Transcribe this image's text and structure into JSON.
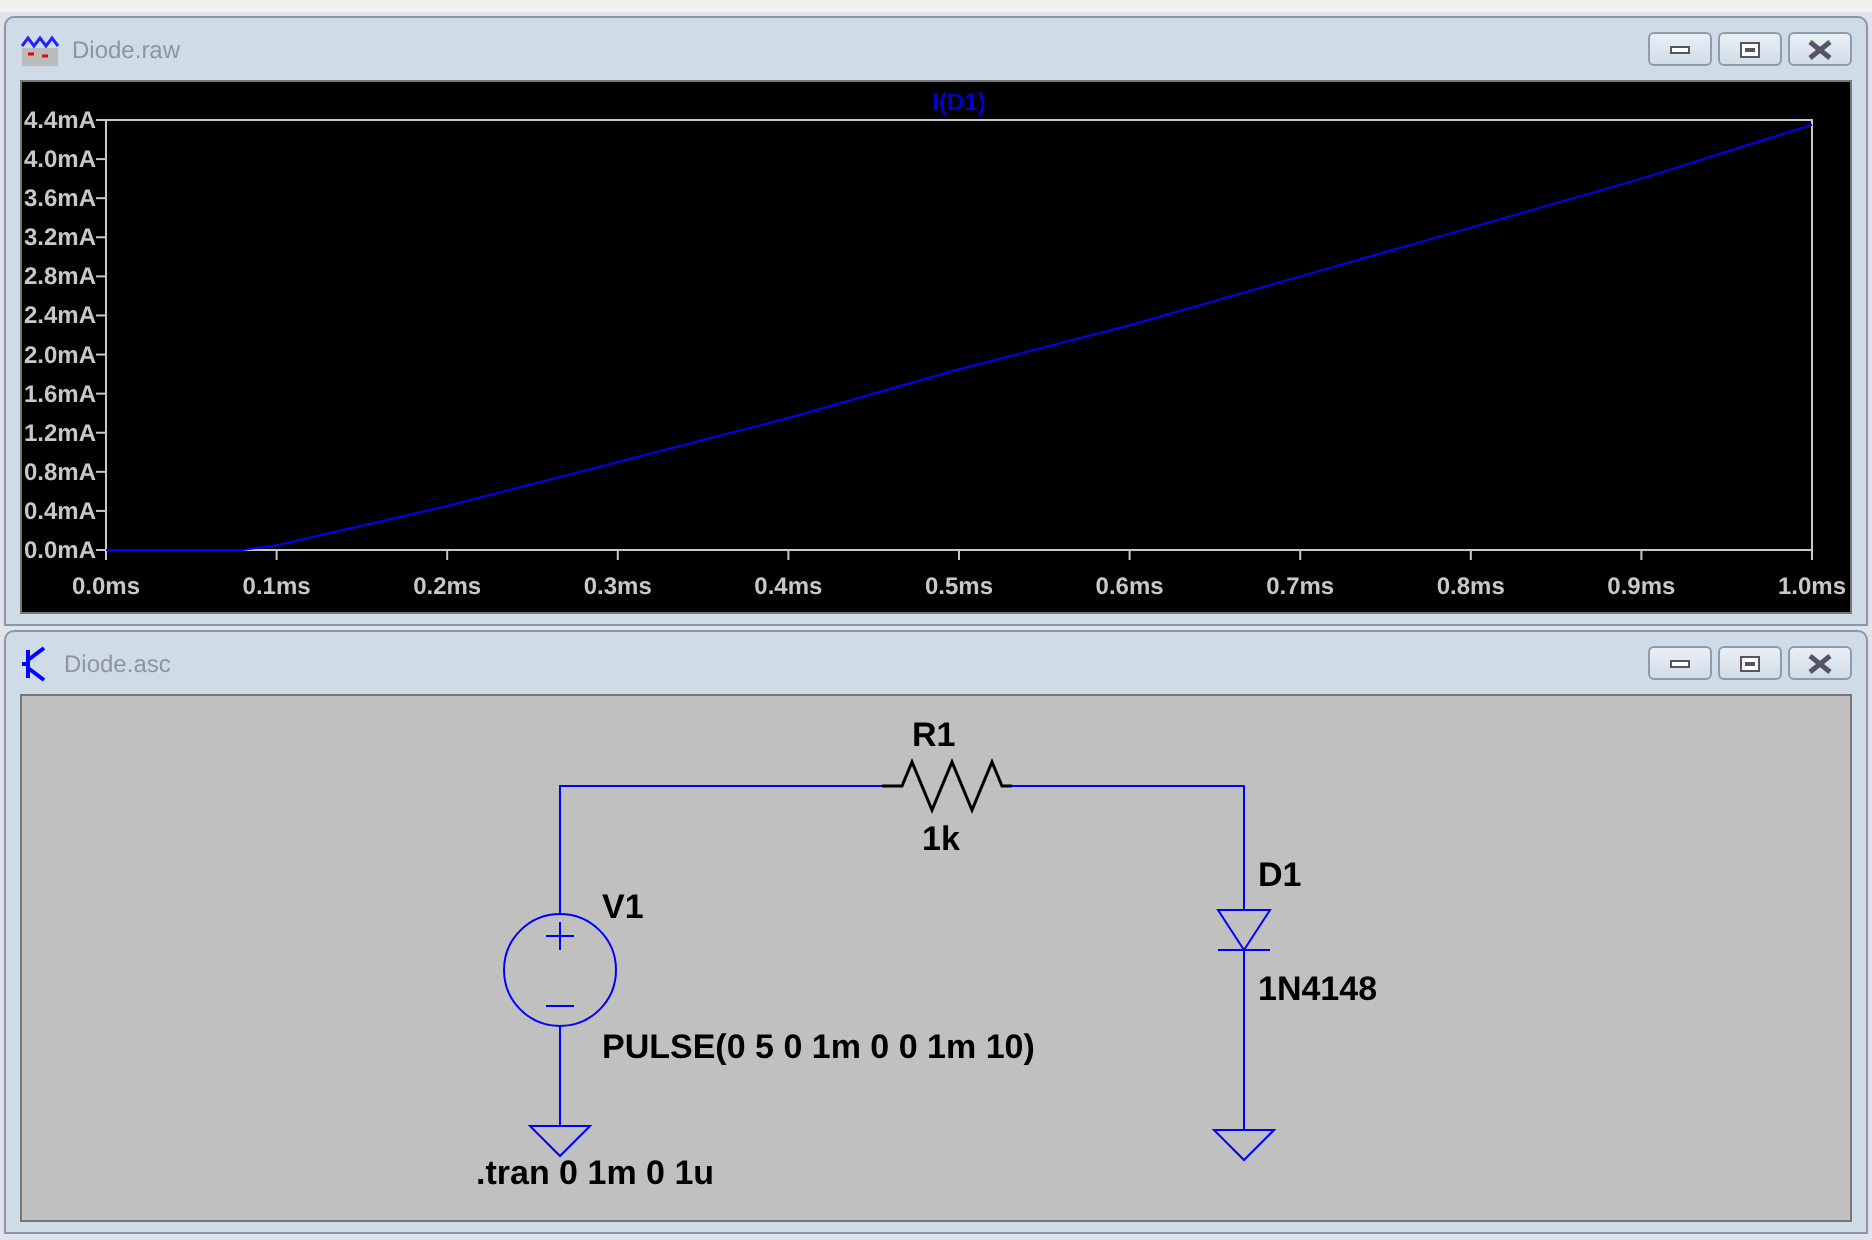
{
  "waveform_window": {
    "title": "Diode.raw",
    "chart_data": {
      "type": "line",
      "x": [
        0,
        0.08,
        0.1,
        0.2,
        0.3,
        0.4,
        0.5,
        0.6,
        0.7,
        0.8,
        0.9,
        1.0
      ],
      "series": [
        {
          "name": "I(D1)",
          "color": "#0000ff",
          "values": [
            0,
            0,
            0.05,
            0.45,
            0.9,
            1.35,
            1.85,
            2.3,
            2.8,
            3.3,
            3.8,
            4.35
          ]
        }
      ],
      "xlim": [
        0,
        1
      ],
      "ylim": [
        0,
        4.4
      ],
      "xticks": [
        {
          "value": 0,
          "label": "0.0ms"
        },
        {
          "value": 0.1,
          "label": "0.1ms"
        },
        {
          "value": 0.2,
          "label": "0.2ms"
        },
        {
          "value": 0.3,
          "label": "0.3ms"
        },
        {
          "value": 0.4,
          "label": "0.4ms"
        },
        {
          "value": 0.5,
          "label": "0.5ms"
        },
        {
          "value": 0.6,
          "label": "0.6ms"
        },
        {
          "value": 0.7,
          "label": "0.7ms"
        },
        {
          "value": 0.8,
          "label": "0.8ms"
        },
        {
          "value": 0.9,
          "label": "0.9ms"
        },
        {
          "value": 1.0,
          "label": "1.0ms"
        }
      ],
      "yticks": [
        {
          "value": 0,
          "label": "0.0mA"
        },
        {
          "value": 0.4,
          "label": "0.4mA"
        },
        {
          "value": 0.8,
          "label": "0.8mA"
        },
        {
          "value": 1.2,
          "label": "1.2mA"
        },
        {
          "value": 1.6,
          "label": "1.6mA"
        },
        {
          "value": 2.0,
          "label": "2.0mA"
        },
        {
          "value": 2.4,
          "label": "2.4mA"
        },
        {
          "value": 2.8,
          "label": "2.8mA"
        },
        {
          "value": 3.2,
          "label": "3.2mA"
        },
        {
          "value": 3.6,
          "label": "3.6mA"
        },
        {
          "value": 4.0,
          "label": "4.0mA"
        },
        {
          "value": 4.4,
          "label": "4.4mA"
        }
      ]
    }
  },
  "schematic_window": {
    "title": "Diode.asc",
    "components": [
      {
        "kind": "resistor",
        "name": "R1",
        "value": "1k"
      },
      {
        "kind": "diode",
        "name": "D1",
        "value": "1N4148"
      },
      {
        "kind": "voltage_source",
        "name": "V1",
        "value": "PULSE(0 5 0 1m 0 0 1m 10)"
      }
    ],
    "directive": ".tran 0 1m 0 1u"
  }
}
